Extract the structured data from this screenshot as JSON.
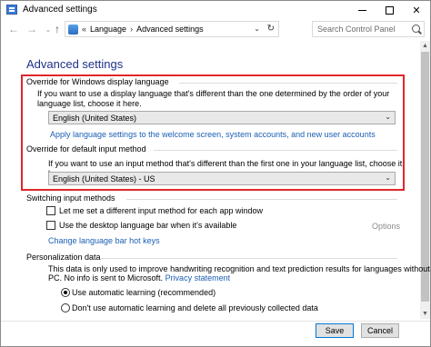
{
  "window": {
    "title": "Advanced settings"
  },
  "nav": {
    "back": "←",
    "forward": "→",
    "recent": "⌄",
    "up": "↑",
    "chevron": "«",
    "breadcrumb": [
      "Language",
      "Advanced settings"
    ],
    "crumb_separator": "›",
    "dropdown": "⌄",
    "refresh": "↻"
  },
  "search": {
    "placeholder": "Search Control Panel"
  },
  "page": {
    "title": "Advanced settings"
  },
  "display_language": {
    "heading": "Override for Windows display language",
    "description": "If you want to use a display language that's different than the one determined by the order of your language list, choose it here.",
    "selected": "English (United States)",
    "link": "Apply language settings to the welcome screen, system accounts, and new user accounts"
  },
  "input_method": {
    "heading": "Override for default input method",
    "description": "If you want to use an input method that's different than the first one in your language list, choose it here.",
    "selected": "English (United States) - US"
  },
  "switching": {
    "heading": "Switching input methods",
    "option1": "Let me set a different input method for each app window",
    "option2": "Use the desktop language bar when it's available",
    "options_label": "Options",
    "link": "Change language bar hot keys"
  },
  "personalization": {
    "heading": "Personalization data",
    "description_line1": "This data is only used to improve handwriting recognition and text prediction results for languages without IMEs on this",
    "description_line2_prefix": "PC. No info is sent to Microsoft.",
    "privacy_link": "Privacy statement",
    "radio1": "Use automatic learning (recommended)",
    "radio2": "Don't use automatic learning and delete all previously collected data"
  },
  "buttons": {
    "save": "Save",
    "cancel": "Cancel"
  },
  "icons": {
    "app": "control-panel-icon",
    "search": "search-icon",
    "chevron": "chevron-down-icon"
  },
  "colors": {
    "title": "#1e3287",
    "link": "#1a5fb4",
    "highlight": "#e0262b"
  }
}
